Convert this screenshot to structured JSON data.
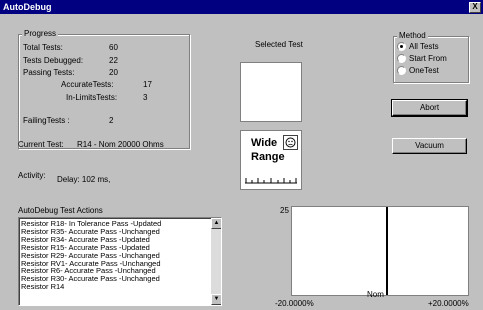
{
  "window": {
    "title": "AutoDebug",
    "close_glyph": "X"
  },
  "progress": {
    "group_label": "Progress",
    "total_tests_label": "Total Tests:",
    "total_tests_value": "60",
    "tests_debugged_label": "Tests Debugged:",
    "tests_debugged_value": "22",
    "passing_tests_label": "Passing Tests:",
    "passing_tests_value": "20",
    "accurate_tests_label": "AccurateTests:",
    "accurate_tests_value": "17",
    "in_limits_tests_label": "In-LimitsTests:",
    "in_limits_tests_value": "3",
    "failing_tests_label": "FailingTests :",
    "failing_tests_value": "2"
  },
  "current_test": {
    "label": "Current Test:",
    "value": "R14 - Nom 20000 Ohms"
  },
  "activity": {
    "label": "Activity:",
    "value": "Delay: 102 ms,"
  },
  "selected_test": {
    "label": "Selected Test"
  },
  "method": {
    "group_label": "Method",
    "options": [
      {
        "label": "All Tests",
        "selected": true
      },
      {
        "label": "Start From",
        "selected": false
      },
      {
        "label": "OneTest",
        "selected": false
      }
    ]
  },
  "buttons": {
    "abort": "Abort",
    "vacuum": "Vacuum"
  },
  "wide_range": {
    "line1": "Wide",
    "line2": "Range",
    "icon": "face-icon"
  },
  "actions": {
    "label": "AutoDebug Test Actions",
    "items": [
      "Resistor R18- In Tolerance Pass -Updated",
      "Resistor R35- Accurate Pass -Unchanged",
      "Resistor R34- Accurate Pass -Updated",
      "Resistor R15- Accurate Pass -Updated",
      "Resistor R29- Accurate Pass -Unchanged",
      "Resistor RV1- Accurate Pass -Unchanged",
      "Resistor R6- Accurate Pass -Unchanged",
      "Resistor R30- Accurate Pass -Unchanged",
      "Resistor R14"
    ]
  },
  "histogram": {
    "y_max_label": "25",
    "x_min_label": "-20.0000%",
    "x_mid_label": "Nom",
    "x_max_label": "+20.0000%",
    "marker_value": 0
  }
}
